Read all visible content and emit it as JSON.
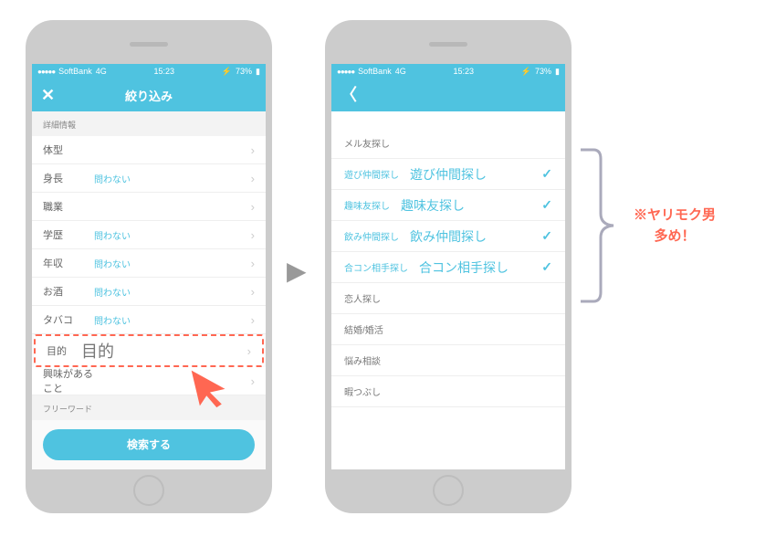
{
  "status": {
    "carrier": "SoftBank",
    "network": "4G",
    "time": "15:23",
    "battery": "73%"
  },
  "screen1": {
    "title": "絞り込み",
    "close": "✕",
    "section_detail": "詳細情報",
    "rows": [
      {
        "label": "体型",
        "value": ""
      },
      {
        "label": "身長",
        "value": "問わない"
      },
      {
        "label": "職業",
        "value": ""
      },
      {
        "label": "学歴",
        "value": "問わない"
      },
      {
        "label": "年収",
        "value": "問わない"
      },
      {
        "label": "お酒",
        "value": "問わない"
      },
      {
        "label": "タバコ",
        "value": "問わない"
      },
      {
        "label": "目的",
        "value": "",
        "highlight": true
      },
      {
        "label": "興味があること",
        "value": ""
      }
    ],
    "highlight_overlay": "目的",
    "section_freeword": "フリーワード",
    "search": "検索する"
  },
  "screen2": {
    "back": "〈",
    "options": [
      {
        "label": "メル友探し",
        "highlight": false
      },
      {
        "label": "遊び仲間探し",
        "overlay": "遊び仲間探し",
        "highlight": true
      },
      {
        "label": "趣味友探し",
        "overlay": "趣味友探し",
        "highlight": true
      },
      {
        "label": "飲み仲間探し",
        "overlay": "飲み仲間探し",
        "highlight": true
      },
      {
        "label": "合コン相手探し",
        "overlay": "合コン相手探し",
        "highlight": true
      },
      {
        "label": "恋人探し",
        "highlight": false
      },
      {
        "label": "結婚/婚活",
        "highlight": false
      },
      {
        "label": "悩み相談",
        "highlight": false
      },
      {
        "label": "暇つぶし",
        "highlight": false
      }
    ]
  },
  "annotation": {
    "line1": "※ヤリモク男",
    "line2": "多め！"
  },
  "arrow": "▶"
}
